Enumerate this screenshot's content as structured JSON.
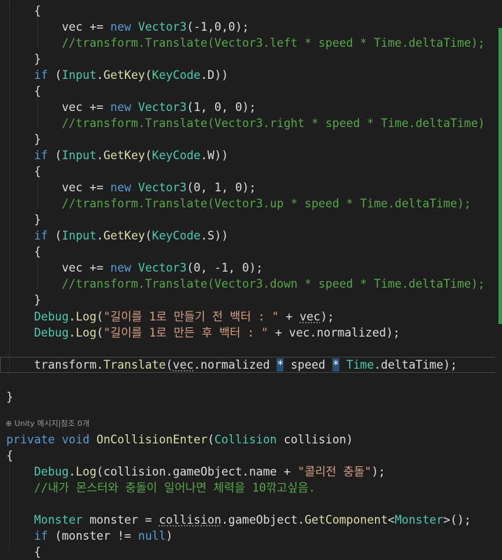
{
  "editor": {
    "language": "C#",
    "codelens_text": "Unity 메시지|참조 0개",
    "lines": [
      {
        "tokens": [
          {
            "t": "    {",
            "c": ""
          }
        ]
      },
      {
        "tokens": [
          {
            "t": "        vec += ",
            "c": ""
          },
          {
            "t": "new",
            "c": "kw"
          },
          {
            "t": " ",
            "c": ""
          },
          {
            "t": "Vector3",
            "c": "ty"
          },
          {
            "t": "(-1,0,0);",
            "c": ""
          }
        ]
      },
      {
        "tokens": [
          {
            "t": "        //transform.Translate(Vector3.left * speed * Time.deltaTime);",
            "c": "cmt"
          }
        ]
      },
      {
        "tokens": [
          {
            "t": "    }",
            "c": ""
          }
        ]
      },
      {
        "tokens": [
          {
            "t": "    ",
            "c": ""
          },
          {
            "t": "if",
            "c": "kw"
          },
          {
            "t": " (",
            "c": ""
          },
          {
            "t": "Input",
            "c": "ty"
          },
          {
            "t": ".",
            "c": ""
          },
          {
            "t": "GetKey",
            "c": "fn"
          },
          {
            "t": "(",
            "c": ""
          },
          {
            "t": "KeyCode",
            "c": "ty"
          },
          {
            "t": ".D))",
            "c": ""
          }
        ]
      },
      {
        "tokens": [
          {
            "t": "    {",
            "c": ""
          }
        ]
      },
      {
        "tokens": [
          {
            "t": "        vec += ",
            "c": ""
          },
          {
            "t": "new",
            "c": "kw"
          },
          {
            "t": " ",
            "c": ""
          },
          {
            "t": "Vector3",
            "c": "ty"
          },
          {
            "t": "(1, 0, 0);",
            "c": ""
          }
        ]
      },
      {
        "tokens": [
          {
            "t": "        //transform.Translate(Vector3.right * speed * Time.deltaTime)",
            "c": "cmt"
          }
        ]
      },
      {
        "tokens": [
          {
            "t": "    }",
            "c": ""
          }
        ]
      },
      {
        "tokens": [
          {
            "t": "    ",
            "c": ""
          },
          {
            "t": "if",
            "c": "kw"
          },
          {
            "t": " (",
            "c": ""
          },
          {
            "t": "Input",
            "c": "ty"
          },
          {
            "t": ".",
            "c": ""
          },
          {
            "t": "GetKey",
            "c": "fn"
          },
          {
            "t": "(",
            "c": ""
          },
          {
            "t": "KeyCode",
            "c": "ty"
          },
          {
            "t": ".W))",
            "c": ""
          }
        ]
      },
      {
        "tokens": [
          {
            "t": "    {",
            "c": ""
          }
        ]
      },
      {
        "tokens": [
          {
            "t": "        vec += ",
            "c": ""
          },
          {
            "t": "new",
            "c": "kw"
          },
          {
            "t": " ",
            "c": ""
          },
          {
            "t": "Vector3",
            "c": "ty"
          },
          {
            "t": "(0, 1, 0);",
            "c": ""
          }
        ]
      },
      {
        "tokens": [
          {
            "t": "        //transform.Translate(Vector3.up * speed * Time.deltaTime);",
            "c": "cmt"
          }
        ]
      },
      {
        "tokens": [
          {
            "t": "    }",
            "c": ""
          }
        ]
      },
      {
        "tokens": [
          {
            "t": "    ",
            "c": ""
          },
          {
            "t": "if",
            "c": "kw"
          },
          {
            "t": " (",
            "c": ""
          },
          {
            "t": "Input",
            "c": "ty"
          },
          {
            "t": ".",
            "c": ""
          },
          {
            "t": "GetKey",
            "c": "fn"
          },
          {
            "t": "(",
            "c": ""
          },
          {
            "t": "KeyCode",
            "c": "ty"
          },
          {
            "t": ".S))",
            "c": ""
          }
        ]
      },
      {
        "tokens": [
          {
            "t": "    {",
            "c": ""
          }
        ]
      },
      {
        "tokens": [
          {
            "t": "        vec += ",
            "c": ""
          },
          {
            "t": "new",
            "c": "kw"
          },
          {
            "t": " ",
            "c": ""
          },
          {
            "t": "Vector3",
            "c": "ty"
          },
          {
            "t": "(0, -1, 0);",
            "c": ""
          }
        ]
      },
      {
        "tokens": [
          {
            "t": "        //transform.Translate(Vector3.down * speed * Time.deltaTime);",
            "c": "cmt"
          }
        ]
      },
      {
        "tokens": [
          {
            "t": "    }",
            "c": ""
          }
        ]
      },
      {
        "tokens": [
          {
            "t": "    ",
            "c": ""
          },
          {
            "t": "Debug",
            "c": "ty"
          },
          {
            "t": ".",
            "c": ""
          },
          {
            "t": "Log",
            "c": "fn"
          },
          {
            "t": "(",
            "c": ""
          },
          {
            "t": "\"길이를 1로 만들기 전 백터 : \"",
            "c": "str"
          },
          {
            "t": " + ",
            "c": ""
          },
          {
            "t": "vec",
            "c": "squig"
          },
          {
            "t": ");",
            "c": ""
          }
        ]
      },
      {
        "tokens": [
          {
            "t": "    ",
            "c": ""
          },
          {
            "t": "Debug",
            "c": "ty"
          },
          {
            "t": ".",
            "c": ""
          },
          {
            "t": "Log",
            "c": "fn"
          },
          {
            "t": "(",
            "c": ""
          },
          {
            "t": "\"길이를 1로 만든 후 백터 : \"",
            "c": "str"
          },
          {
            "t": " + vec.normalized);",
            "c": ""
          }
        ]
      },
      {
        "tokens": [
          {
            "t": "",
            "c": ""
          }
        ]
      },
      {
        "tokens": [
          {
            "t": "    transform.",
            "c": ""
          },
          {
            "t": "Translate",
            "c": "fn"
          },
          {
            "t": "(",
            "c": ""
          },
          {
            "t": "vec",
            "c": "squig"
          },
          {
            "t": ".normalized ",
            "c": ""
          },
          {
            "t": "*",
            "c": "hl"
          },
          {
            "t": " speed ",
            "c": ""
          },
          {
            "t": "*",
            "c": "hl"
          },
          {
            "t": " ",
            "c": ""
          },
          {
            "t": "Time",
            "c": "ty"
          },
          {
            "t": ".deltaTime);",
            "c": ""
          }
        ]
      },
      {
        "tokens": [
          {
            "t": "",
            "c": ""
          }
        ]
      },
      {
        "tokens": [
          {
            "t": "}",
            "c": ""
          }
        ]
      },
      {
        "tokens": [
          {
            "t": "",
            "c": ""
          }
        ]
      },
      {
        "tokens": [
          {
            "t": "",
            "c": ""
          }
        ]
      },
      {
        "tokens": [
          {
            "t": "private",
            "c": "kw"
          },
          {
            "t": " ",
            "c": ""
          },
          {
            "t": "void",
            "c": "kw"
          },
          {
            "t": " ",
            "c": ""
          },
          {
            "t": "OnCollisionEnter",
            "c": "fn"
          },
          {
            "t": "(",
            "c": ""
          },
          {
            "t": "Collision",
            "c": "ty"
          },
          {
            "t": " collision)",
            "c": ""
          }
        ]
      },
      {
        "tokens": [
          {
            "t": "{",
            "c": ""
          }
        ]
      },
      {
        "tokens": [
          {
            "t": "    ",
            "c": ""
          },
          {
            "t": "Debug",
            "c": "ty"
          },
          {
            "t": ".",
            "c": ""
          },
          {
            "t": "Log",
            "c": "fn"
          },
          {
            "t": "(collision.gameObject.name + ",
            "c": ""
          },
          {
            "t": "\"콜리전 충돌\"",
            "c": "str"
          },
          {
            "t": ");",
            "c": ""
          }
        ]
      },
      {
        "tokens": [
          {
            "t": "    //내가 몬스터와 충돌이 일어나면 체력을 10깎고싶음.",
            "c": "cmt"
          }
        ]
      },
      {
        "tokens": [
          {
            "t": "",
            "c": ""
          }
        ]
      },
      {
        "tokens": [
          {
            "t": "    ",
            "c": ""
          },
          {
            "t": "Monster",
            "c": "ty"
          },
          {
            "t": " monster = ",
            "c": ""
          },
          {
            "t": "collision",
            "c": "squig"
          },
          {
            "t": ".gameObject.",
            "c": ""
          },
          {
            "t": "GetComponent",
            "c": "fn"
          },
          {
            "t": "<",
            "c": ""
          },
          {
            "t": "Monster",
            "c": "ty"
          },
          {
            "t": ">();",
            "c": ""
          }
        ]
      },
      {
        "tokens": [
          {
            "t": "    ",
            "c": ""
          },
          {
            "t": "if",
            "c": "kw"
          },
          {
            "t": " (monster != ",
            "c": ""
          },
          {
            "t": "null",
            "c": "kw"
          },
          {
            "t": ")",
            "c": ""
          }
        ]
      },
      {
        "tokens": [
          {
            "t": "    {",
            "c": ""
          }
        ]
      }
    ]
  },
  "colors": {
    "background": "#1e1e1e",
    "keyword": "#569cd6",
    "type": "#4ec9b0",
    "method": "#dcdcaa",
    "string": "#d69d85",
    "comment": "#57a64a",
    "change_marker": "#2ea043"
  }
}
